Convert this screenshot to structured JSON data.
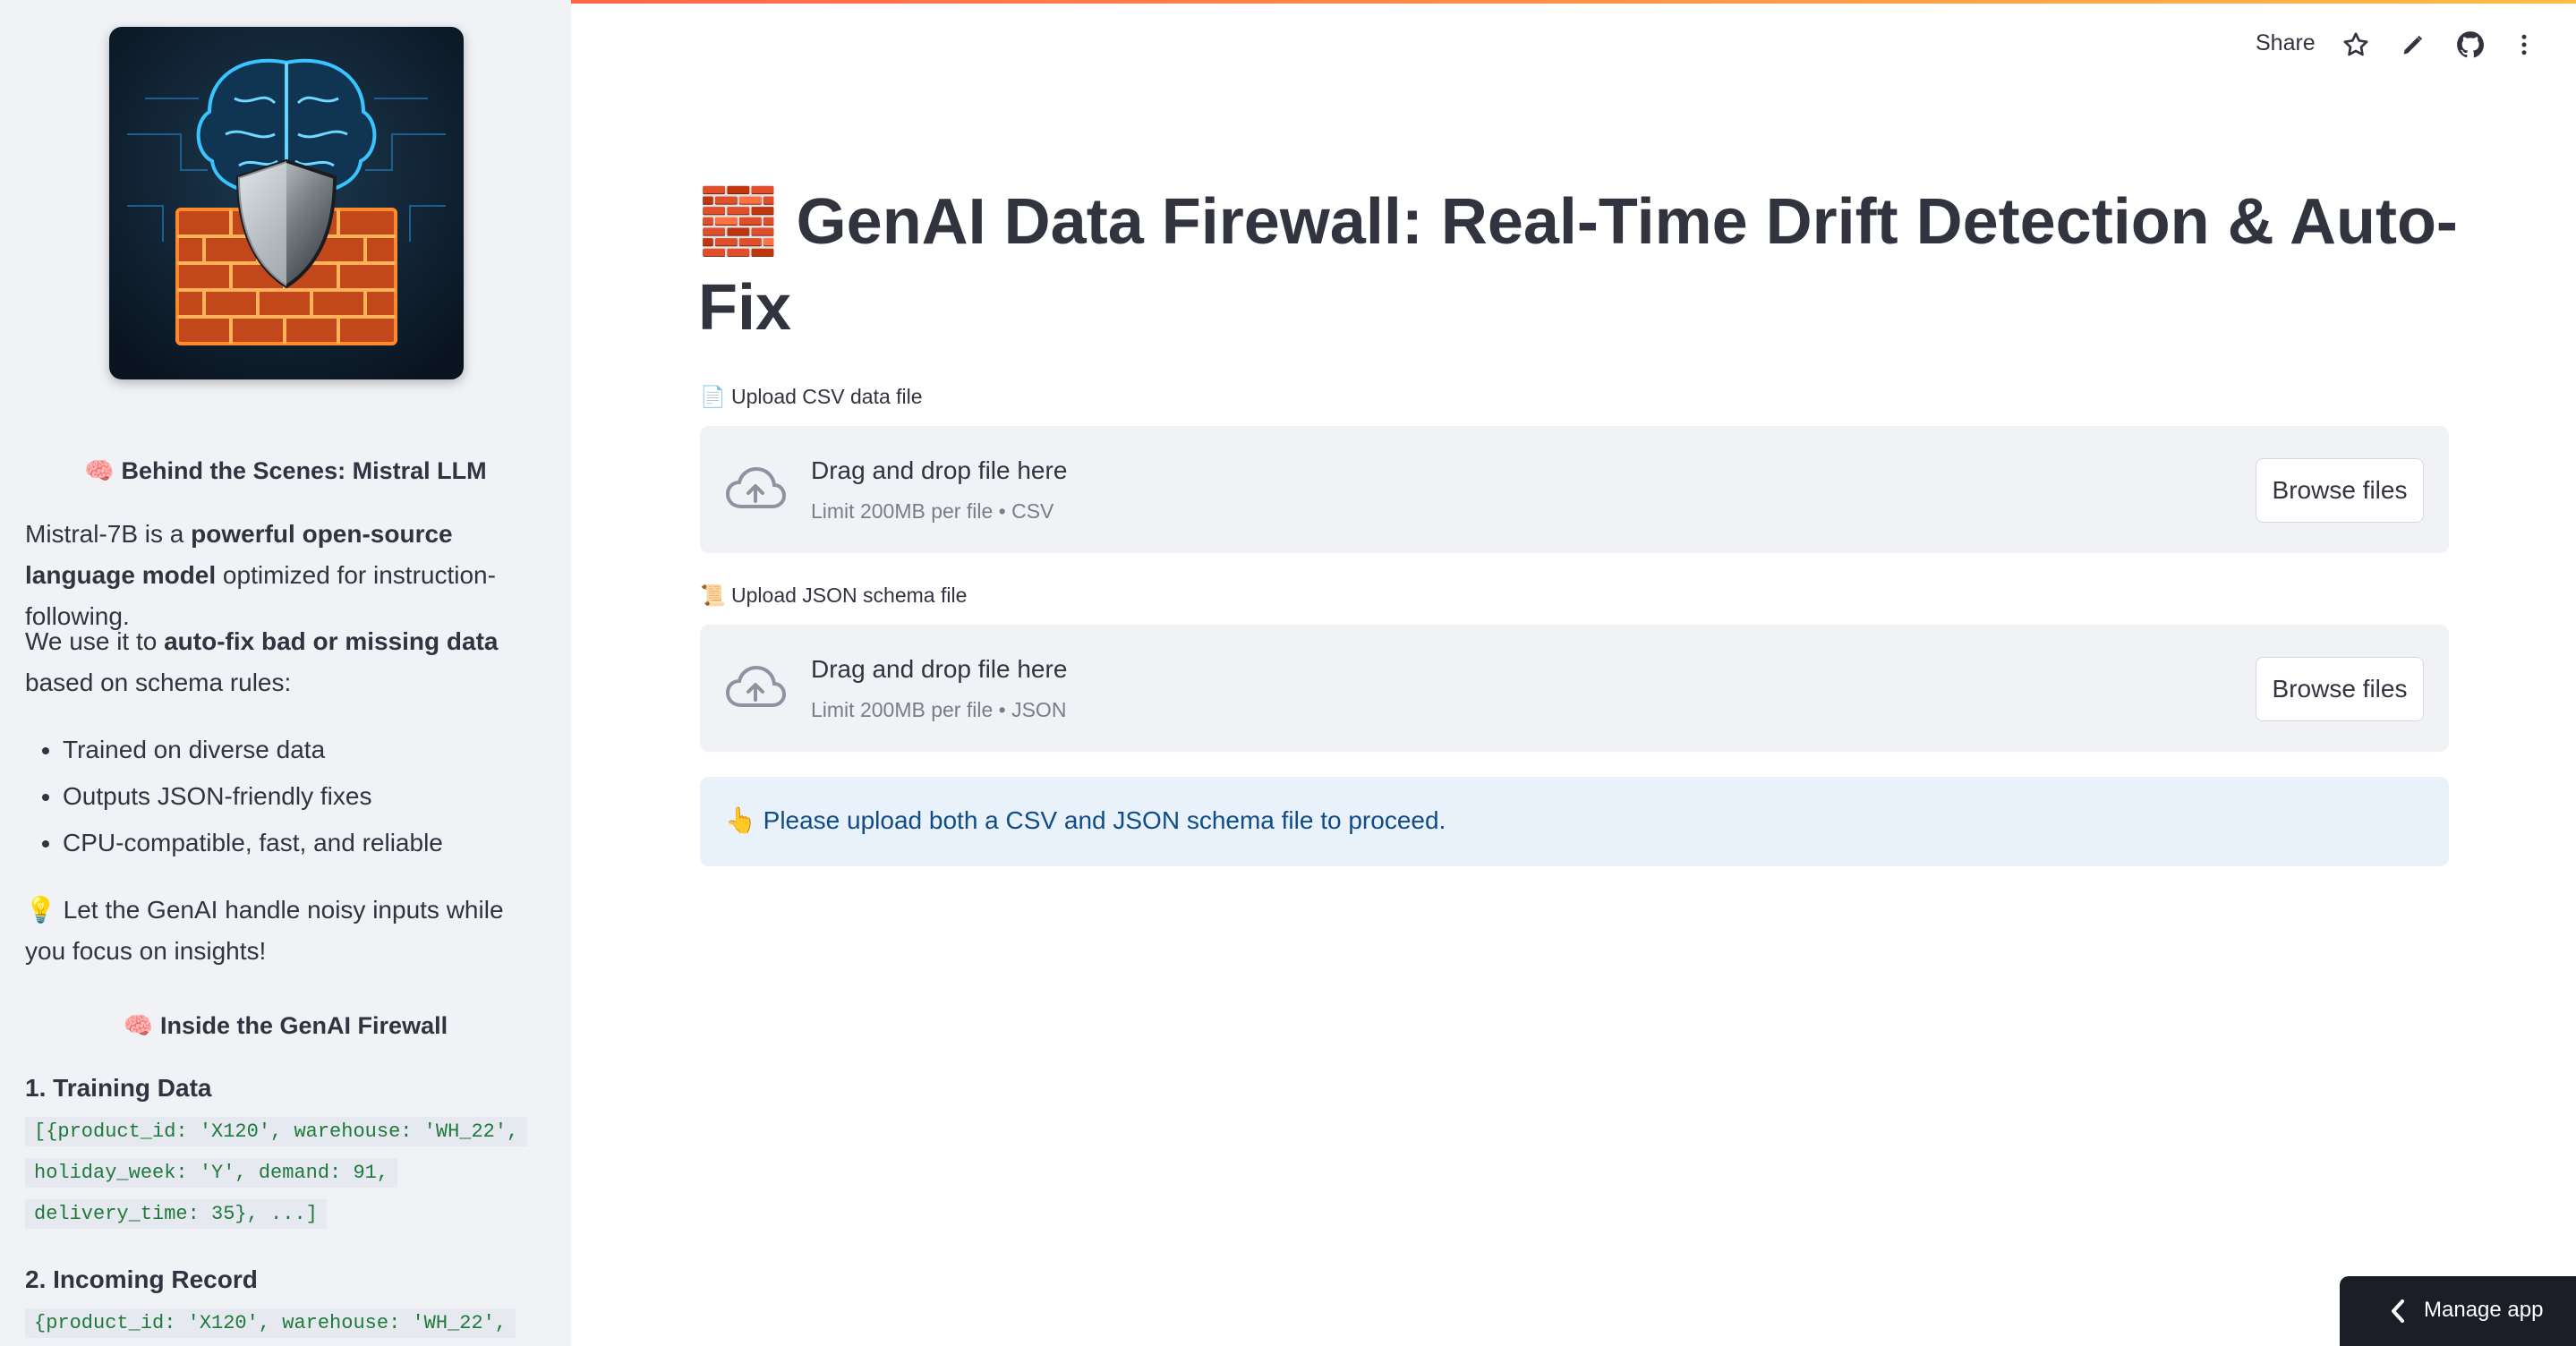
{
  "toolbar": {
    "share_label": "Share",
    "icons": [
      "star-icon",
      "edit-pencil-icon",
      "github-icon",
      "more-vertical-icon"
    ]
  },
  "sidebar": {
    "heading1": "🧠 Behind the Scenes: Mistral LLM",
    "para1_a": "Mistral-7B is a ",
    "para1_b": "powerful open-source language model",
    "para1_c": " optimized for instruction-following.",
    "para2_a": "We use it to ",
    "para2_b": "auto-fix bad or missing data",
    "para2_c": " based on schema rules:",
    "bullets": [
      "Trained on diverse data",
      "Outputs JSON-friendly fixes",
      "CPU-compatible, fast, and reliable"
    ],
    "para3": "💡 Let the GenAI handle noisy inputs while you focus on insights!",
    "heading2": "🧠 Inside the GenAI Firewall",
    "sub1": "1. Training Data",
    "code1": [
      "[{product_id: 'X120', warehouse: 'WH_22',",
      "holiday_week: 'Y', demand: 91,",
      "delivery_time: 35}, ...]"
    ],
    "sub2": "2. Incoming Record",
    "code2": [
      "{product_id: 'X120', warehouse: 'WH_22',"
    ]
  },
  "main": {
    "title": "🧱 GenAI Data Firewall: Real-Time Drift Detection & Auto-Fix",
    "csv_upload": {
      "label": "📄 Upload CSV data file",
      "drop_text": "Drag and drop file here",
      "limit": "Limit 200MB per file • CSV",
      "button": "Browse files"
    },
    "json_upload": {
      "label": "📜 Upload JSON schema file",
      "drop_text": "Drag and drop file here",
      "limit": "Limit 200MB per file • JSON",
      "button": "Browse files"
    },
    "info": "👆 Please upload both a CSV and JSON schema file to proceed."
  },
  "manage_app": {
    "label": "Manage app"
  },
  "colors": {
    "sidebar_bg": "#f0f2f6",
    "info_bg": "#e9f1fb",
    "info_text": "#0f4c8a",
    "accent_gradient_start": "#ff4b4b",
    "accent_gradient_end": "#ffbd45",
    "code_text": "#1e7a3a"
  }
}
